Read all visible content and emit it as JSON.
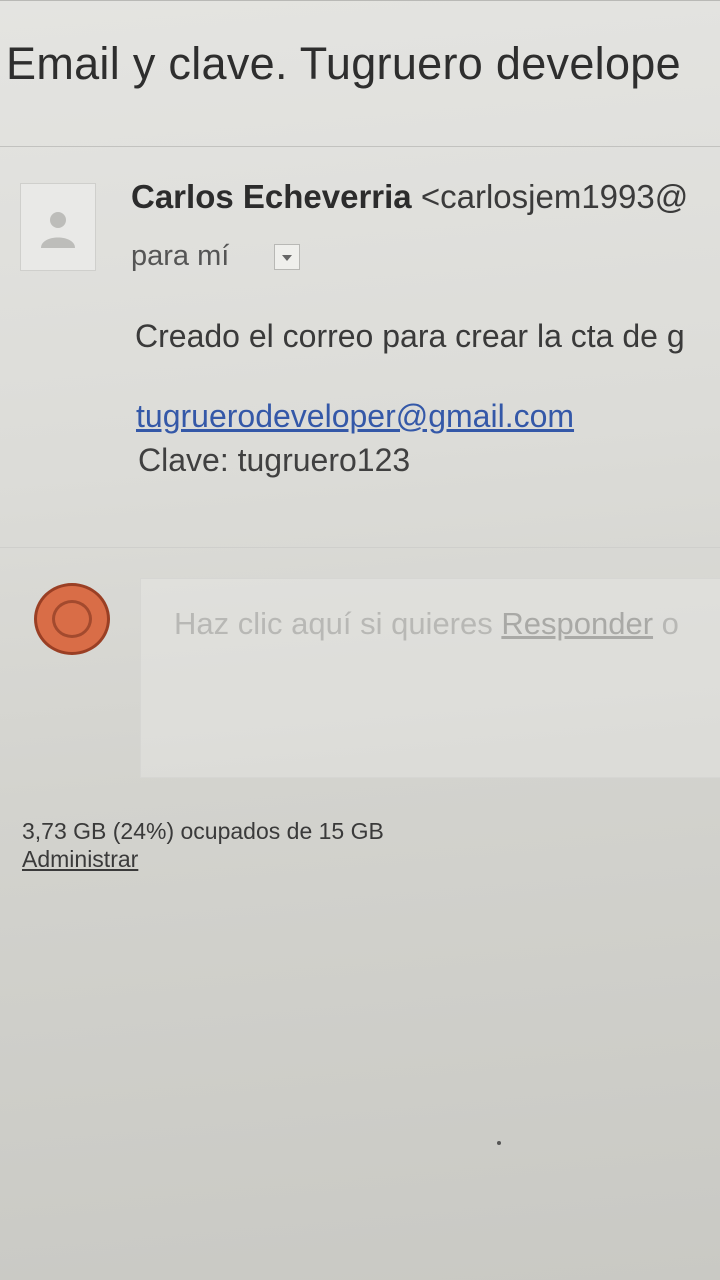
{
  "email": {
    "subject": "Email y clave. Tugruero develope",
    "sender": {
      "name": "Carlos Echeverria",
      "address": "<carlosjem1993@"
    },
    "recipient_label": "para mí",
    "body_text": "Creado el correo para crear la cta de g",
    "email_link": "tugruerodeveloper@gmail.com",
    "password_line": "Clave: tugruero123"
  },
  "reply": {
    "prompt_prefix": "Haz clic aquí si quieres ",
    "reply_link": "Responder",
    "prompt_suffix": " o"
  },
  "footer": {
    "storage_text": "3,73 GB (24%) ocupados de 15 GB",
    "manage_link": "Administrar"
  },
  "colors": {
    "link": "#3458a8",
    "reply_avatar": "#d96d47"
  }
}
